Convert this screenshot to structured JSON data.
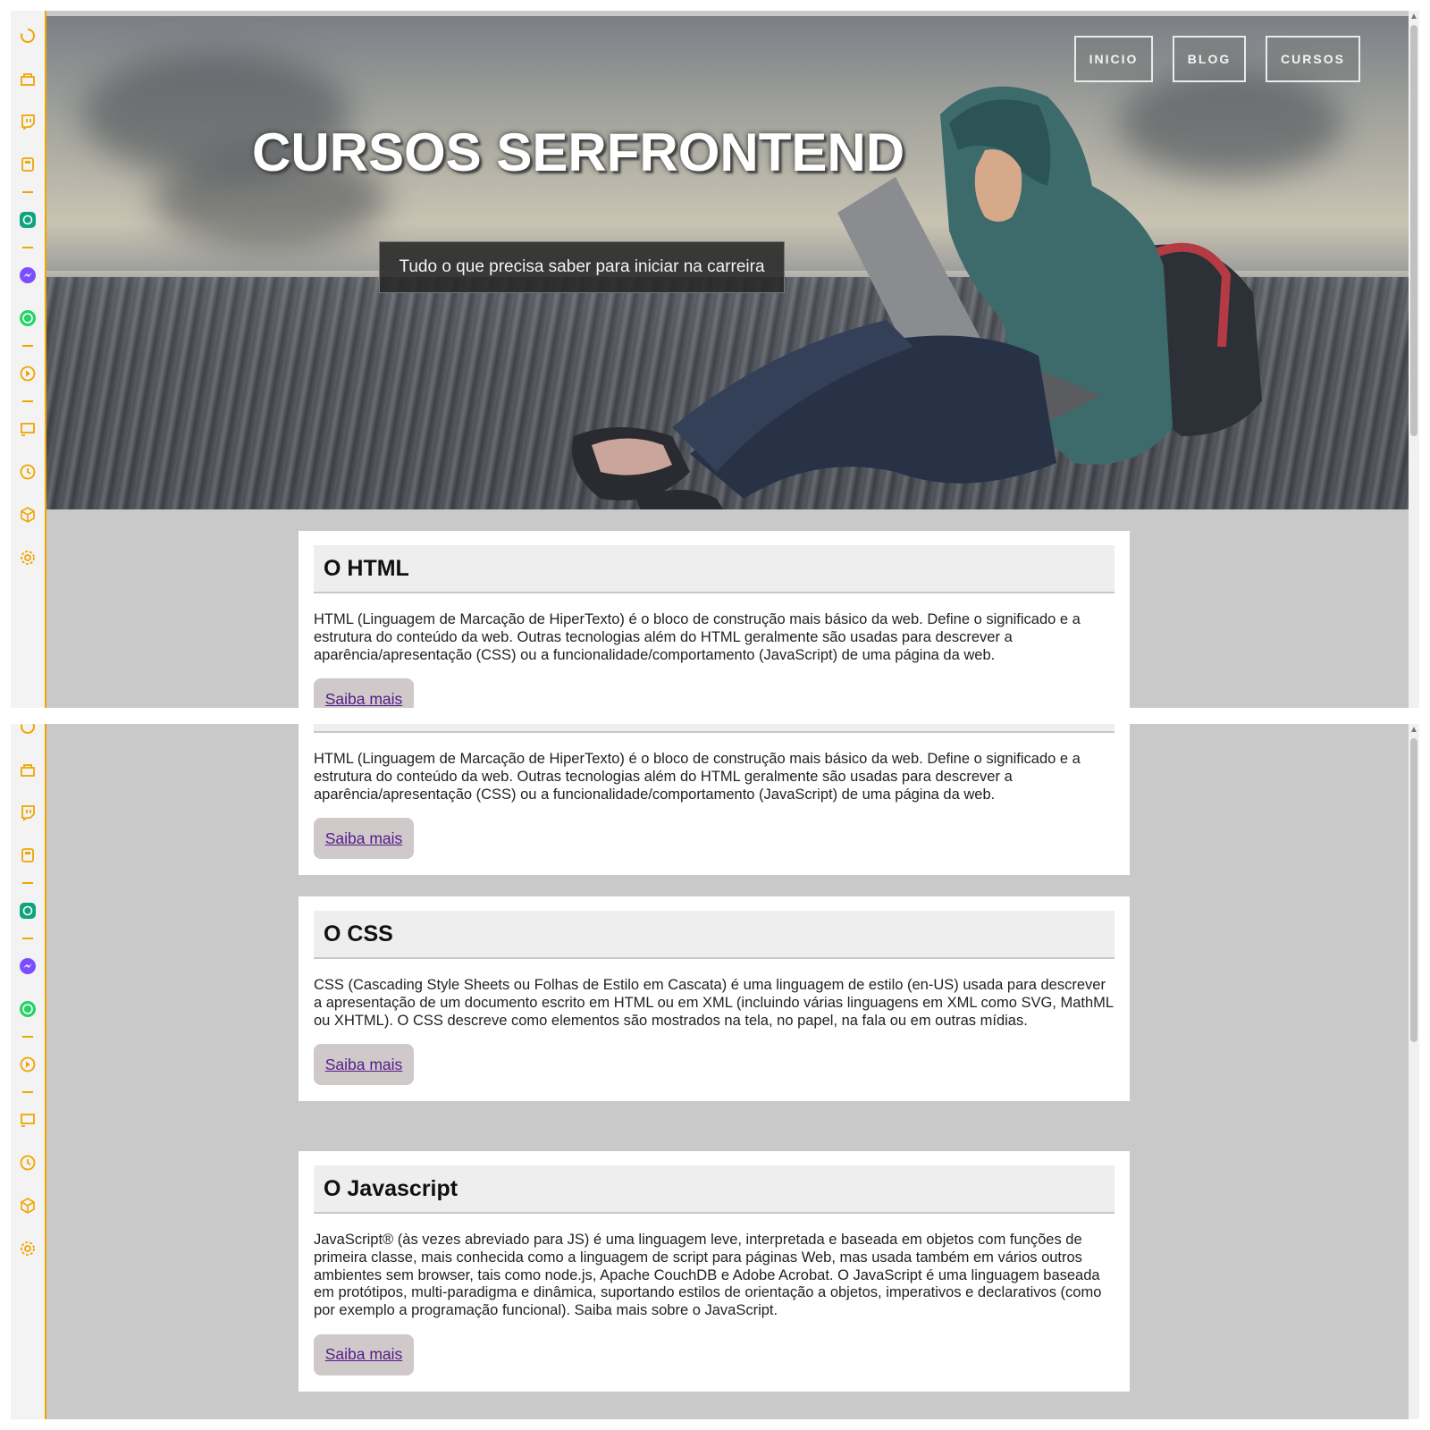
{
  "nav": {
    "inicio": "INICIO",
    "blog": "BLOG",
    "cursos": "CURSOS"
  },
  "hero": {
    "title": "CURSOS SERFRONTEND",
    "subtitle": "Tudo o que precisa saber para iniciar na carreira"
  },
  "sidebar": {
    "icons": [
      "circle-arrow-icon",
      "store-icon",
      "twitch-icon",
      "calculator-icon",
      "chatgpt-icon",
      "messenger-icon",
      "whatsapp-icon",
      "play-icon",
      "cast-icon",
      "clock-icon",
      "cube-icon",
      "settings-icon",
      "gallery-icon"
    ]
  },
  "cards": [
    {
      "title": "O HTML",
      "text": "HTML (Linguagem de Marcação de HiperTexto) é o bloco de construção mais básico da web. Define o significado e a estrutura do conteúdo da web. Outras tecnologias além do HTML geralmente são usadas para descrever a aparência/apresentação (CSS) ou a funcionalidade/comportamento (JavaScript) de uma página da web.",
      "button": "Saiba mais"
    },
    {
      "title": "O CSS",
      "text": "CSS (Cascading Style Sheets ou Folhas de Estilo em Cascata) é uma linguagem de estilo (en-US) usada para descrever a apresentação de um documento escrito em HTML ou em XML (incluindo várias linguagens em XML como SVG, MathML ou XHTML). O CSS descreve como elementos são mostrados na tela, no papel, na fala ou em outras mídias.",
      "button": "Saiba mais"
    },
    {
      "title": "O Javascript",
      "text": "JavaScript® (às vezes abreviado para JS) é uma linguagem leve, interpretada e baseada em objetos com funções de primeira classe, mais conhecida como a linguagem de script para páginas Web, mas usada também em vários outros ambientes sem browser, tais como node.js, Apache CouchDB e Adobe Acrobat. O JavaScript é uma linguagem baseada em protótipos, multi-paradigma e dinâmica, suportando estilos de orientação a objetos, imperativos e declarativos (como por exemplo a programação funcional). Saiba mais sobre o JavaScript.",
      "button": "Saiba mais"
    }
  ],
  "colors": {
    "sidebar_accent": "#f0a500",
    "link": "#551a8b",
    "page_bg": "#c9c9c9"
  }
}
